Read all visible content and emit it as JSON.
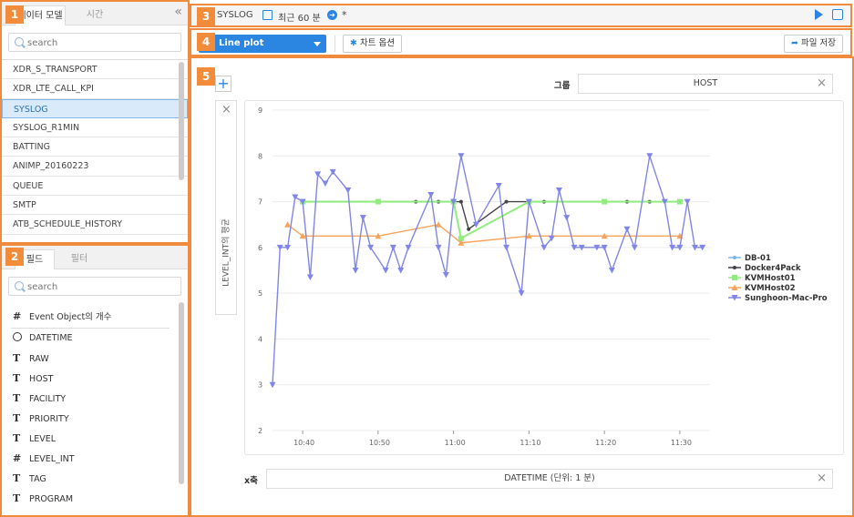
{
  "left_top": {
    "tabs": [
      "데이터 모델",
      "시간"
    ],
    "search_placeholder": "search",
    "items": [
      "XDR_S_TRANSPORT",
      "XDR_LTE_CALL_KPI",
      "SYSLOG",
      "SYSLOG_R1MIN",
      "BATTING",
      "ANIMP_20160223",
      "QUEUE",
      "SMTP",
      "ATB_SCHEDULE_HISTORY"
    ],
    "selected": "SYSLOG"
  },
  "left_bottom": {
    "tabs": [
      "필드",
      "필터"
    ],
    "search_placeholder": "search",
    "fields": [
      {
        "type": "#",
        "name": "Event Object의 개수"
      },
      {
        "type": "clock",
        "name": "DATETIME"
      },
      {
        "type": "T",
        "name": "RAW"
      },
      {
        "type": "T",
        "name": "HOST"
      },
      {
        "type": "T",
        "name": "FACILITY"
      },
      {
        "type": "T",
        "name": "PRIORITY"
      },
      {
        "type": "T",
        "name": "LEVEL"
      },
      {
        "type": "#",
        "name": "LEVEL_INT"
      },
      {
        "type": "T",
        "name": "TAG"
      },
      {
        "type": "T",
        "name": "PROGRAM"
      }
    ]
  },
  "badges": [
    "1",
    "2",
    "3",
    "4",
    "5"
  ],
  "topbar": {
    "title": "SYSLOG",
    "time": "최근 60 분",
    "star": "*"
  },
  "toolbar": {
    "chart_type": "Line plot",
    "options": "차트 옵션",
    "save": "파일 저장"
  },
  "main": {
    "group_label": "그룹",
    "group_value": "HOST",
    "x_label": "x축",
    "x_value": "DATETIME (단위: 1 분)",
    "y_label": "LEVEL_INT의 평균"
  },
  "colors": {
    "accent": "#2a86e0",
    "badge": "#f28b3a"
  },
  "chart_data": {
    "type": "line",
    "ylim": [
      2,
      9
    ],
    "yticks": [
      2,
      3,
      4,
      5,
      6,
      7,
      8,
      9
    ],
    "xticks": [
      "10:40",
      "10:50",
      "11:00",
      "11:10",
      "11:20",
      "11:30"
    ],
    "xlabel": "DATETIME (단위: 1 분)",
    "ylabel": "LEVEL_INT의 평균",
    "legend_position": "right",
    "series": [
      {
        "name": "DB-01",
        "color": "#7cb5ec",
        "marker": "circle",
        "points": []
      },
      {
        "name": "Docker4Pack",
        "color": "#434348",
        "marker": "circle",
        "points": [
          [
            0,
            7
          ],
          [
            15,
            7
          ],
          [
            18,
            7
          ],
          [
            21,
            7
          ],
          [
            22,
            6.4
          ],
          [
            27,
            7
          ],
          [
            32,
            7
          ],
          [
            40,
            7
          ],
          [
            43,
            7
          ],
          [
            46,
            7
          ]
        ]
      },
      {
        "name": "KVMHost01",
        "color": "#90ed7d",
        "marker": "square",
        "points": [
          [
            0,
            7
          ],
          [
            10,
            7
          ],
          [
            20,
            7
          ],
          [
            21,
            6.2
          ],
          [
            30,
            7
          ],
          [
            40,
            7
          ],
          [
            50,
            7
          ]
        ]
      },
      {
        "name": "KVMHost02",
        "color": "#f7a35c",
        "marker": "triangle",
        "points": [
          [
            -2,
            6.5
          ],
          [
            0,
            6.25
          ],
          [
            10,
            6.25
          ],
          [
            18,
            6.5
          ],
          [
            21,
            6.1
          ],
          [
            30,
            6.25
          ],
          [
            40,
            6.25
          ],
          [
            50,
            6.25
          ]
        ]
      },
      {
        "name": "Sunghoon-Mac-Pro",
        "color": "#8085e9",
        "marker": "triangle-down",
        "points": [
          [
            -4,
            3
          ],
          [
            -3,
            6
          ],
          [
            -2,
            6
          ],
          [
            -1,
            7.1
          ],
          [
            0,
            7
          ],
          [
            1,
            5.35
          ],
          [
            2,
            7.6
          ],
          [
            3,
            7.4
          ],
          [
            4,
            7.65
          ],
          [
            6,
            7.25
          ],
          [
            7,
            5.5
          ],
          [
            8,
            6.65
          ],
          [
            9,
            6
          ],
          [
            11,
            5.5
          ],
          [
            12,
            6
          ],
          [
            13,
            5.5
          ],
          [
            14,
            6
          ],
          [
            17,
            7.15
          ],
          [
            18,
            6
          ],
          [
            19,
            5.4
          ],
          [
            20,
            7
          ],
          [
            21,
            8
          ],
          [
            23,
            6.5
          ],
          [
            26,
            7.35
          ],
          [
            27,
            6
          ],
          [
            29,
            5
          ],
          [
            30,
            7
          ],
          [
            32,
            6
          ],
          [
            33,
            6.2
          ],
          [
            34,
            7.25
          ],
          [
            35,
            6.65
          ],
          [
            36,
            6
          ],
          [
            37,
            6
          ],
          [
            39,
            6
          ],
          [
            40,
            6
          ],
          [
            41,
            5.5
          ],
          [
            43,
            6.4
          ],
          [
            44,
            6
          ],
          [
            46,
            8
          ],
          [
            48,
            7
          ],
          [
            49,
            6
          ],
          [
            50,
            6
          ],
          [
            51,
            7
          ],
          [
            52,
            6
          ],
          [
            53,
            6
          ]
        ]
      }
    ],
    "x_domain_minutes_from_1040": [
      -4,
      54
    ]
  }
}
